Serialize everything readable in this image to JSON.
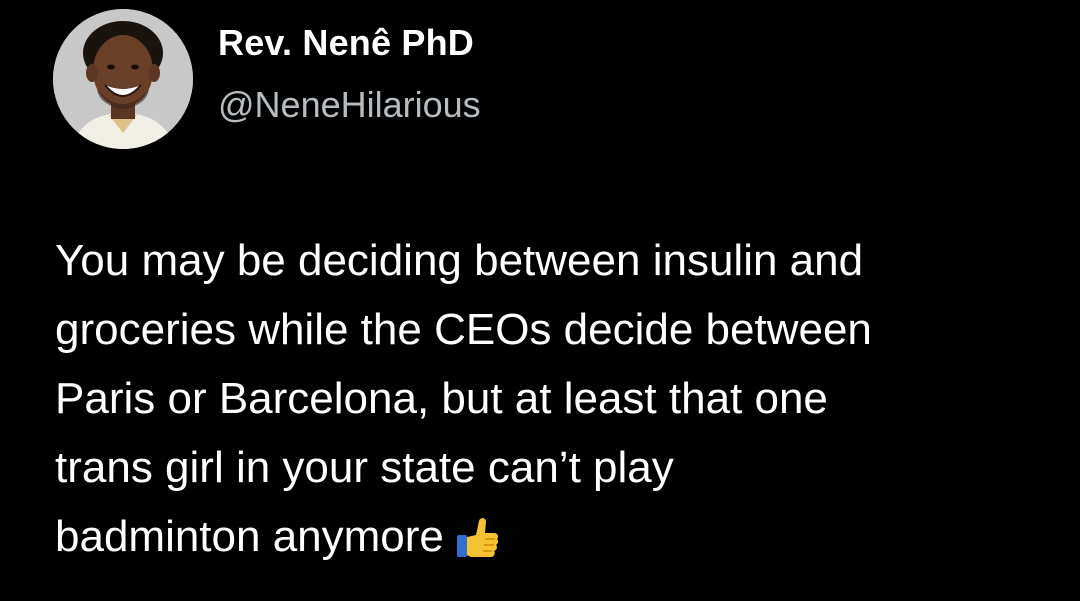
{
  "author": {
    "display_name": "Rev. Nenê PhD",
    "handle": "@NeneHilarious"
  },
  "tweet": {
    "lines": [
      "You may be deciding between insulin and",
      "groceries while the CEOs decide between",
      "Paris or Barcelona, but at least that one",
      "trans girl in your state can’t play",
      "badminton anymore"
    ],
    "emoji": "thumbs-up-icon"
  }
}
